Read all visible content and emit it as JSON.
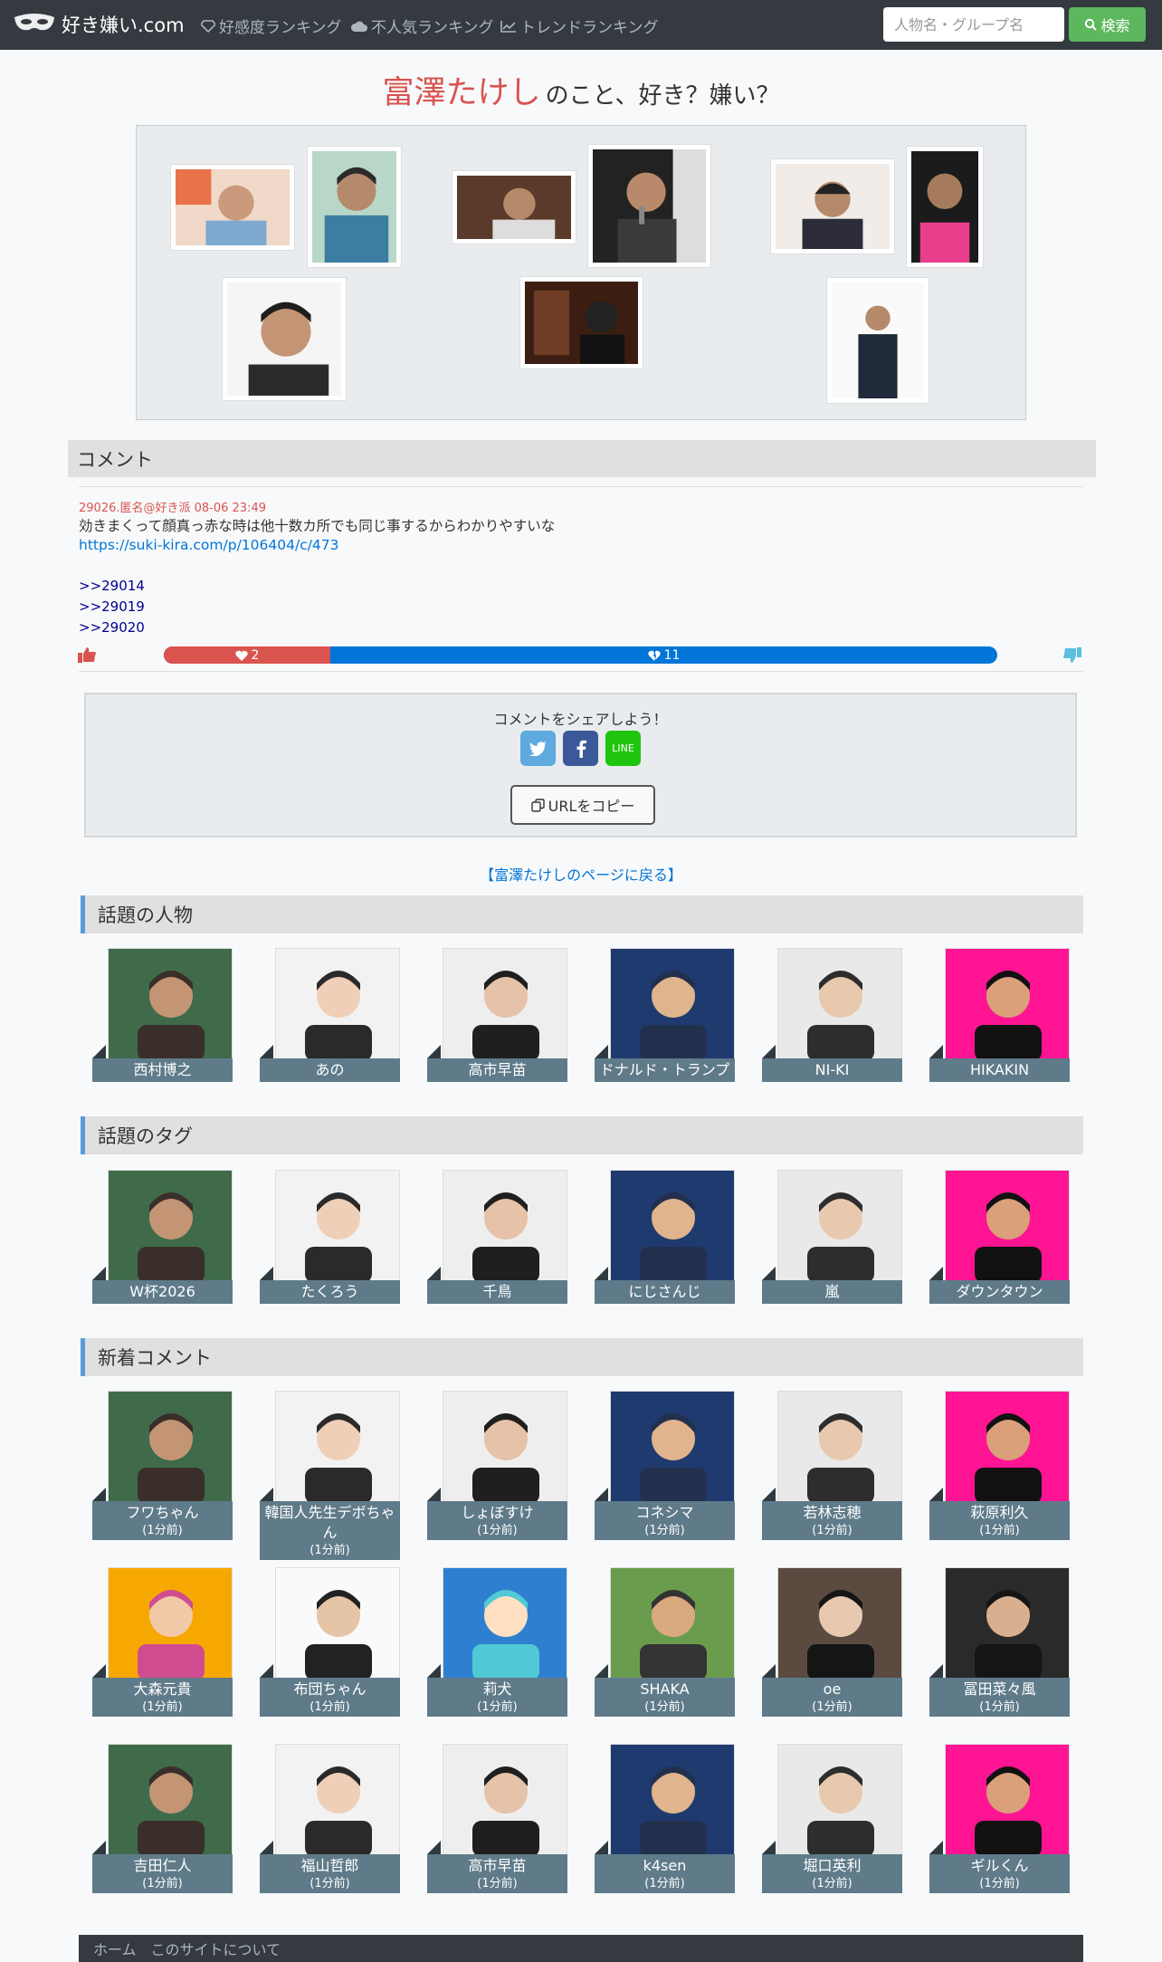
{
  "nav": {
    "brand": "好き嫌い.com",
    "links": [
      "好感度ランキング",
      "不人気ランキング",
      "トレンドランキング"
    ],
    "search_placeholder": "人物名・グループ名",
    "search_button": "検索"
  },
  "title": {
    "name": "富澤たけし",
    "suffix": "のこと、好き？嫌い？"
  },
  "comment_section": {
    "heading": "コメント",
    "meta": "29026.匿名@好き派 08-06 23:49",
    "text": "効きまくって顔真っ赤な時は他十数カ所でも同じ事するからわかりやすいな",
    "link": "https://suki-kira.com/p/106404/c/473",
    "replies": [
      ">>29014",
      ">>29019",
      ">>29020"
    ],
    "likes": "2",
    "dislikes": "11",
    "like_fraction": 0.2
  },
  "share": {
    "title": "コメントをシェアしよう！",
    "line_label": "LINE",
    "copy_label": "URLをコピー"
  },
  "back_link": "【富澤たけしのページに戻る】",
  "trending_people": {
    "heading": "話題の人物",
    "items": [
      {
        "name": "西村博之"
      },
      {
        "name": "あの"
      },
      {
        "name": "高市早苗"
      },
      {
        "name": "ドナルド・トランプ"
      },
      {
        "name": "NI-KI"
      },
      {
        "name": "HIKAKIN"
      }
    ]
  },
  "trending_tags": {
    "heading": "話題のタグ",
    "items": [
      {
        "name": "W杯2026"
      },
      {
        "name": "たくろう"
      },
      {
        "name": "千鳥"
      },
      {
        "name": "にじさんじ"
      },
      {
        "name": "嵐"
      },
      {
        "name": "ダウンタウン"
      }
    ]
  },
  "new_comments": {
    "heading": "新着コメント",
    "items": [
      {
        "name": "フワちゃん",
        "time": "(1分前)"
      },
      {
        "name": "韓国人先生デボちゃん",
        "time": "(1分前)"
      },
      {
        "name": "しょぼすけ",
        "time": "(1分前)"
      },
      {
        "name": "コネシマ",
        "time": "(1分前)"
      },
      {
        "name": "若林志穂",
        "time": "(1分前)"
      },
      {
        "name": "萩原利久",
        "time": "(1分前)"
      },
      {
        "name": "大森元貴",
        "time": "(1分前)"
      },
      {
        "name": "布団ちゃん",
        "time": "(1分前)"
      },
      {
        "name": "莉犬",
        "time": "(1分前)"
      },
      {
        "name": "SHAKA",
        "time": "(1分前)"
      },
      {
        "name": "oe",
        "time": "(1分前)"
      },
      {
        "name": "冨田菜々風",
        "time": "(1分前)"
      },
      {
        "name": "吉田仁人",
        "time": "(1分前)"
      },
      {
        "name": "福山哲郎",
        "time": "(1分前)"
      },
      {
        "name": "高市早苗",
        "time": "(1分前)"
      },
      {
        "name": "k4sen",
        "time": "(1分前)"
      },
      {
        "name": "堀口英利",
        "time": "(1分前)"
      },
      {
        "name": "ギルくん",
        "time": "(1分前)"
      }
    ]
  },
  "footer": {
    "links": [
      "ホーム",
      "このサイトについて"
    ]
  },
  "colors": {
    "accent_red": "#d9534f",
    "accent_blue": "#0275d8",
    "navbar": "#343a40",
    "card_label": "#5f7b8a"
  }
}
